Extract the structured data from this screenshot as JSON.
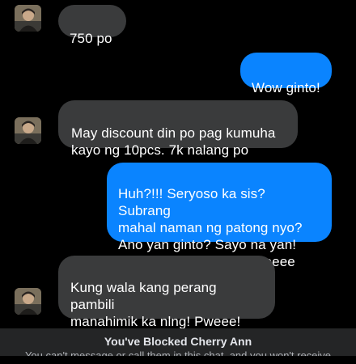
{
  "contact": {
    "avatar_icon": "profile-photo-icon"
  },
  "messages": [
    {
      "direction": "incoming",
      "text": "750 po",
      "avatar": true
    },
    {
      "direction": "outgoing",
      "text": "Wow ginto!"
    },
    {
      "direction": "incoming",
      "text": "May discount din po pag kumuha\nkayo ng 10pcs. 7k nalang po",
      "avatar": true
    },
    {
      "direction": "outgoing",
      "text": "Huh?!!! Seryoso ka sis? Subrang\nmahal naman ng patong nyo?\nAno yan ginto? Sayo na yan!\nMga nananamatala! Pweeee"
    },
    {
      "direction": "incoming",
      "text": "Kung wala kang perang pambili\nmanahimik ka nlng! Pweee!\nWalang pera ka kasi!",
      "avatar": true
    }
  ],
  "blocked_banner": {
    "title": "You've Blocked Cherry Ann",
    "subtitle": "You can't message or call them in this chat, and you won't receive"
  },
  "colors": {
    "background": "#000000",
    "incoming_bubble": "#3a3b3c",
    "outgoing_bubble": "#0a84ff",
    "banner": "#242526"
  }
}
